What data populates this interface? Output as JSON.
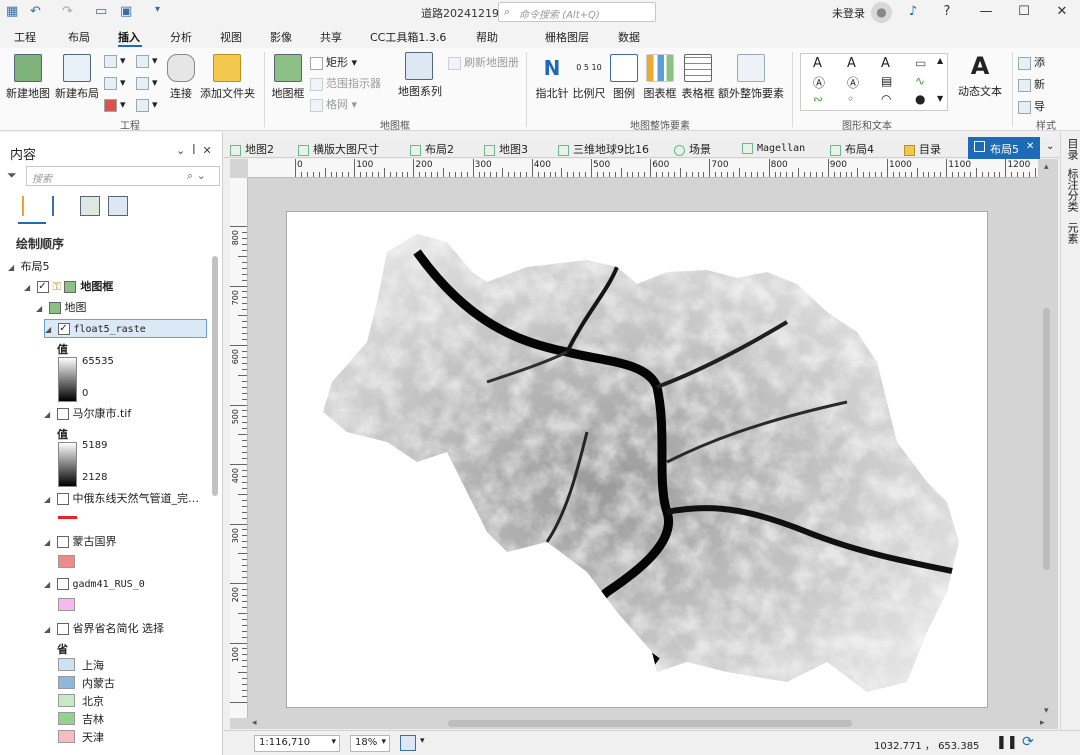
{
  "title_bar": {
    "app_title": "道路20241219",
    "command_search_placeholder": "命令搜索 (Alt+Q)",
    "user": "未登录"
  },
  "ribbon_tabs": [
    "工程",
    "布局",
    "插入",
    "分析",
    "视图",
    "影像",
    "共享",
    "CC工具箱1.3.6",
    "帮助",
    "栅格图层",
    "数据"
  ],
  "active_tab": "插入",
  "ribbon": {
    "project_group": {
      "label": "工程",
      "new_map": "新建地图",
      "new_layout": "新建布局",
      "connect": "连接",
      "add_folder": "添加文件夹"
    },
    "mapframe_group": {
      "label": "地图框",
      "map_frame": "地图框",
      "rectangle": "矩形",
      "extent_indicator": "范围指示器",
      "grid": "格网",
      "map_series": "地图系列",
      "refresh_map_series": "刷新地图册"
    },
    "map_surrounds_group": {
      "label": "地图整饰要素",
      "north_arrow": "指北针",
      "scale_bar": "比例尺",
      "legend": "图例",
      "chart_frame": "图表框",
      "table_frame": "表格框",
      "extra_surrounds": "额外整饰要素",
      "scale_ticks": "0 5 10"
    },
    "graphics_text_group": {
      "label": "图形和文本",
      "dynamic_text": "动态文本"
    },
    "styles_group": {
      "label": "样式",
      "add": "添",
      "new": "新",
      "import": "导"
    }
  },
  "contents_pane": {
    "title": "内容",
    "search_placeholder": "搜索",
    "section": "绘制顺序",
    "tree": {
      "layout": "布局5",
      "map_frame": "地图框",
      "map": "地图",
      "layers": {
        "float_raster": {
          "name": "float5_raste",
          "value_label": "值",
          "max": "65535",
          "min": "0"
        },
        "maerkang": {
          "name": "马尔康市.tif",
          "value_label": "值",
          "max": "5189",
          "min": "2128"
        },
        "pipeline": {
          "name": "中俄东线天然气管道_完…",
          "color": "#e8222a"
        },
        "mongolia": {
          "name": "蒙古国界",
          "color": "#f08a8a"
        },
        "gadm": {
          "name": "gadm41_RUS_0",
          "color": "#f7b8ef"
        },
        "provinces": {
          "name": "省界省名简化 选择",
          "field": "省",
          "classes": [
            {
              "label": "上海",
              "color": "#cfe2f5"
            },
            {
              "label": "内蒙古",
              "color": "#8fb7dc"
            },
            {
              "label": "北京",
              "color": "#c9e8c5"
            },
            {
              "label": "吉林",
              "color": "#95d28e"
            },
            {
              "label": "天津",
              "color": "#f7bcbc"
            }
          ]
        }
      }
    }
  },
  "doc_tabs": [
    "地图2",
    "横版大图尺寸",
    "布局2",
    "地图3",
    "三维地球9比16",
    "场景",
    "Magellan",
    "布局4",
    "目录",
    "布局5"
  ],
  "active_doc_tab": "布局5",
  "right_sidebar": [
    "目录",
    "标注分类",
    "元素"
  ],
  "rulers": {
    "top_ticks": [
      "0",
      "100",
      "200",
      "300",
      "400",
      "500",
      "600",
      "700",
      "800",
      "900",
      "1000",
      "1100",
      "1200"
    ],
    "left_ticks": [
      "800",
      "700",
      "600",
      "500",
      "400",
      "300",
      "200",
      "100"
    ]
  },
  "status_bar": {
    "scale": "1:116,710",
    "zoom": "18%",
    "coordinates": "1032.771 ， 653.385"
  }
}
